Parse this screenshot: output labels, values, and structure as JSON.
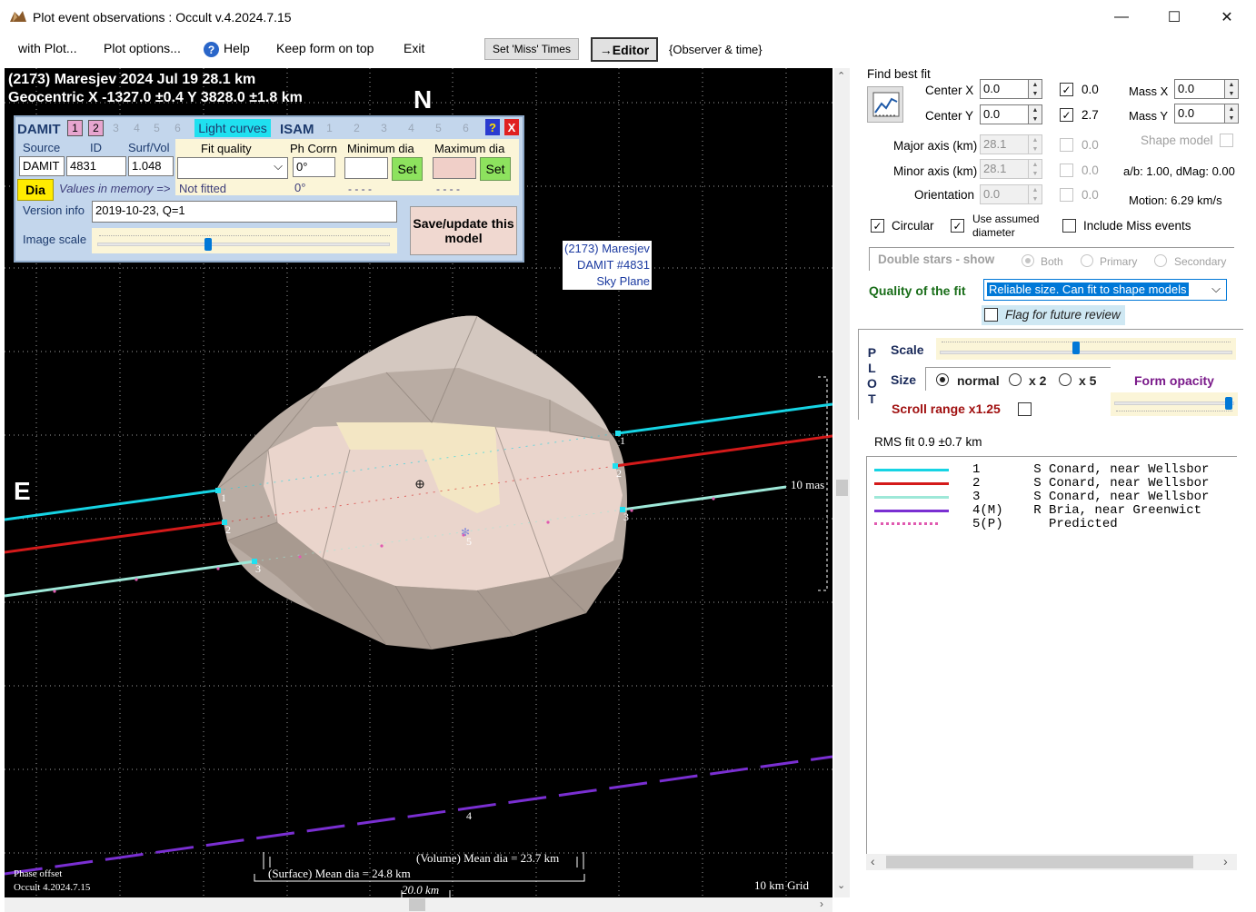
{
  "window": {
    "title": "Plot event observations : Occult v.4.2024.7.15",
    "controls": {
      "minimize": "—",
      "maximize": "☐",
      "close": "✕"
    }
  },
  "menu": {
    "with_plot": "with Plot...",
    "plot_options": "Plot options...",
    "help": "Help",
    "keep_on_top": "Keep form on top",
    "exit": "Exit",
    "set_miss_times": "Set 'Miss' Times",
    "editor": "→Editor",
    "observer_time": "{Observer & time}"
  },
  "plot": {
    "title_line1": "(2173) Maresjev  2024 Jul 19  28.1 km",
    "title_line2": "Geocentric  X  -1327.0 ±0.4  Y 3828.0 ±1.8 km",
    "north": "N",
    "east": "E",
    "shape_label": [
      "(2173) Maresjev",
      "DAMIT #4831",
      "Sky Plane"
    ],
    "scale_10mas": "10 mas",
    "volume_dia": "(Volume) Mean dia = 23.7 km",
    "surface_dia": "(Surface) Mean dia = 24.8 km",
    "scale_bar": "20.0 km",
    "phase_offset": "Phase offset",
    "version": "Occult 4.2024.7.15",
    "grid": "10 km Grid",
    "chord_labels": [
      "1",
      "2",
      "3",
      "4",
      "5"
    ],
    "colors": {
      "chord1": "#16d4e4",
      "chord2": "#d41a1a",
      "chord3": "#9ee8d8",
      "chord4": "#7a2fd2",
      "predicted": "#e05ab0"
    }
  },
  "damit": {
    "tab_damit": "DAMIT",
    "damit_models": [
      "1",
      "2",
      "3",
      "4",
      "5",
      "6"
    ],
    "light_curves": "Light curves",
    "tab_isam": "ISAM",
    "isam_models": [
      "1",
      "2",
      "3",
      "4",
      "5",
      "6"
    ],
    "help": "?",
    "close": "X",
    "source_label": "Source",
    "id_label": "ID",
    "surfvol_label": "Surf/Vol",
    "source_value": "DAMIT",
    "id_value": "4831",
    "surfvol_value": "1.048",
    "fit_quality_label": "Fit quality",
    "fit_quality_value": "",
    "fit_status": "Not fitted",
    "ph_corr_label": "Ph Corrn",
    "ph_corr_value": "0°",
    "ph_corr_memory": "0°",
    "min_dia_label": "Minimum dia",
    "min_dia_value": "",
    "min_dia_memory": "- - - -",
    "max_dia_label": "Maximum dia",
    "max_dia_value": "",
    "max_dia_memory": "- - - -",
    "set": "Set",
    "dia": "Dia",
    "values_in_memory": "Values in memory =>",
    "version_label": "Version info",
    "version_value": "2019-10-23, Q=1",
    "image_scale_label": "Image scale",
    "save_update": "Save/update this model"
  },
  "fit": {
    "find_best_fit": "Find best fit",
    "center_x_label": "Center X",
    "center_x": "0.0",
    "center_y_label": "Center Y",
    "center_y": "0.0",
    "cx_check_value": "0.0",
    "cy_check_value": "2.7",
    "mass_x_label": "Mass X",
    "mass_x": "0.0",
    "mass_y_label": "Mass Y",
    "mass_y": "0.0",
    "major_axis_label": "Major axis (km)",
    "major_axis": "28.1",
    "major_check_value": "0.0",
    "minor_axis_label": "Minor axis (km)",
    "minor_axis": "28.1",
    "minor_check_value": "0.0",
    "orientation_label": "Orientation",
    "orientation": "0.0",
    "orient_check_value": "0.0",
    "shape_model": "Shape model",
    "ab_dmag": "a/b: 1.00, dMag: 0.00",
    "motion": "Motion: 6.29 km/s",
    "circular": "Circular",
    "use_assumed": "Use assumed diameter",
    "include_miss": "Include Miss events",
    "double_stars": "Double stars - show",
    "both": "Both",
    "primary": "Primary",
    "secondary": "Secondary",
    "quality_label": "Quality of the fit",
    "quality_value": "Reliable size. Can fit to shape models",
    "flag_review": "Flag for future review"
  },
  "plot_panel": {
    "plot_letters": [
      "P",
      "L",
      "O",
      "T"
    ],
    "scale": "Scale",
    "size": "Size",
    "normal": "normal",
    "x2": "x 2",
    "x5": "x 5",
    "form_opacity": "Form opacity",
    "scroll_range": "Scroll range x1.25",
    "rms_fit": "RMS fit 0.9 ±0.7 km"
  },
  "legend": [
    {
      "num": "1",
      "flag": "",
      "code": "S",
      "observer": "Conard, near Wellsbor",
      "color": "#16d4e4",
      "style": "solid"
    },
    {
      "num": "2",
      "flag": "",
      "code": "S",
      "observer": "Conard, near Wellsbor",
      "color": "#d41a1a",
      "style": "solid"
    },
    {
      "num": "3",
      "flag": "",
      "code": "S",
      "observer": "Conard, near Wellsbor",
      "color": "#9ee8d8",
      "style": "solid"
    },
    {
      "num": "4",
      "flag": "(M)",
      "code": "R",
      "observer": "Bria, near Greenwict",
      "color": "#7a2fd2",
      "style": "solid"
    },
    {
      "num": "5",
      "flag": "(P)",
      "code": "",
      "observer": "Predicted",
      "color": "#e05ab0",
      "style": "dotted"
    }
  ]
}
